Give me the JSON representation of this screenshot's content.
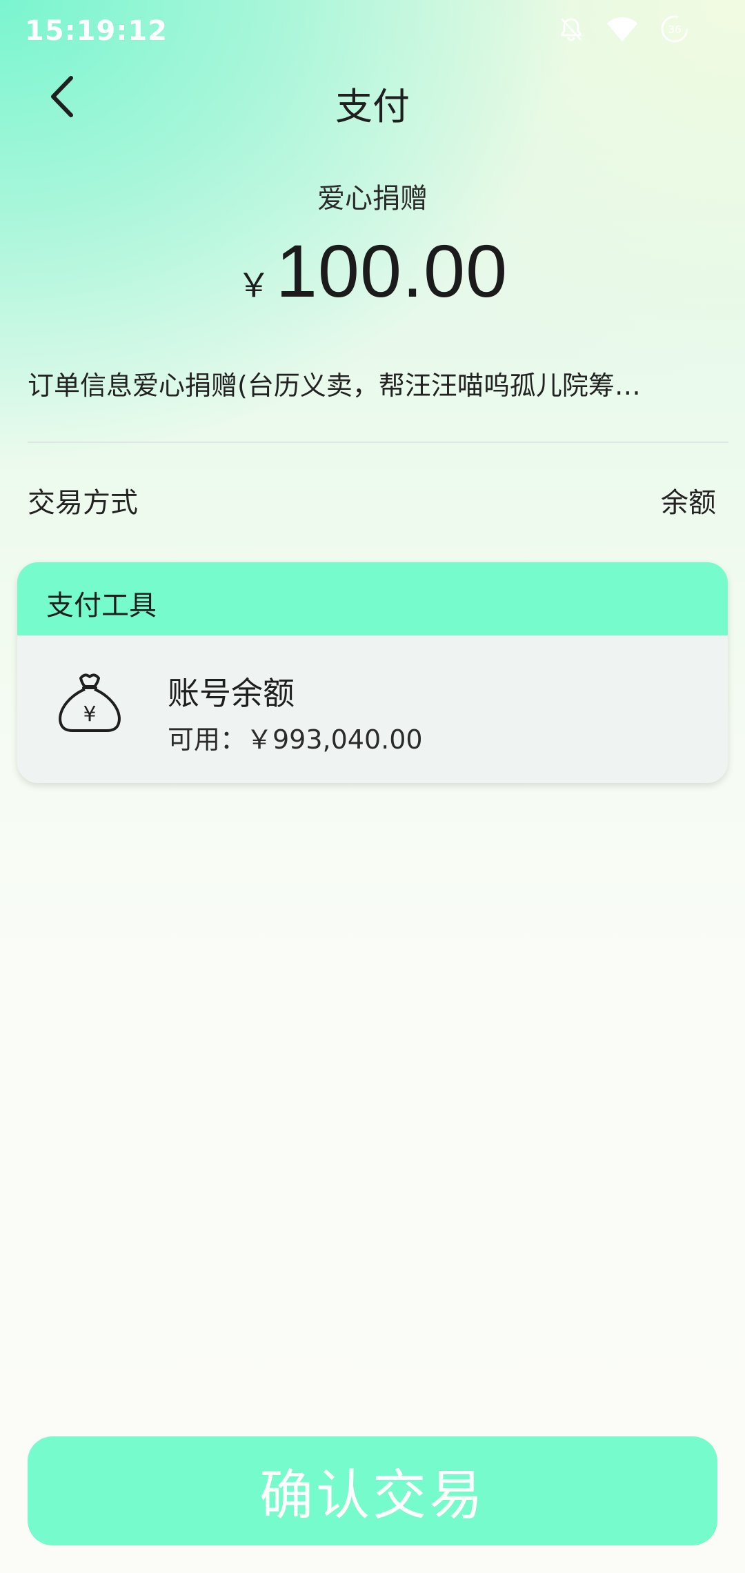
{
  "status_bar": {
    "time": "15:19:12",
    "icons": [
      "bell-muted-icon",
      "wifi-icon",
      "data-saver-icon"
    ],
    "data_saver_label": "36"
  },
  "header": {
    "title": "支付",
    "back_icon": "chevron-left-icon"
  },
  "amount": {
    "label": "爱心捐赠",
    "currency": "￥",
    "value": "100.00"
  },
  "order": {
    "info": "订单信息爱心捐赠(台历义卖，帮汪汪喵呜孤儿院筹…"
  },
  "transaction": {
    "method_label": "交易方式",
    "method_value": "余额"
  },
  "payment_tools": {
    "title": "支付工具",
    "items": [
      {
        "icon": "money-bag-icon",
        "icon_symbol": "¥",
        "name": "账号余额",
        "available": "可用：￥993,040.00"
      }
    ]
  },
  "confirm": {
    "label": "确认交易"
  },
  "colors": {
    "accent": "#76fbcc",
    "card_bg": "#eff4f2",
    "text": "#1d1d1d"
  }
}
